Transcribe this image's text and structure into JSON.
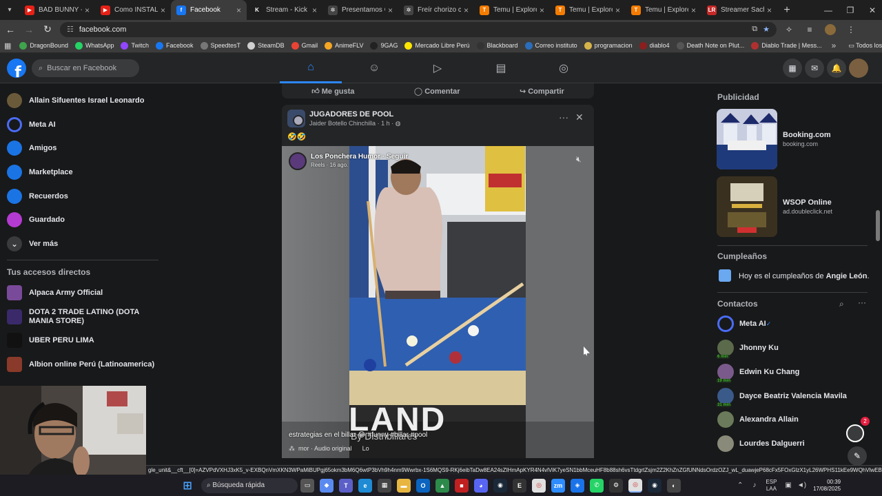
{
  "browser": {
    "tabs": [
      {
        "label": "BAD BUNNY - NI",
        "icon": "youtube-icon",
        "color": "#e62117",
        "glyph": "▶"
      },
      {
        "label": "Como INSTALAR",
        "icon": "youtube-icon",
        "color": "#e62117",
        "glyph": "▶"
      },
      {
        "label": "Facebook",
        "icon": "facebook-icon",
        "color": "#1877f2",
        "glyph": "f",
        "active": true
      },
      {
        "label": "Stream - Kick Da",
        "icon": "kick-icon",
        "color": "#1e1e1e",
        "glyph": "K"
      },
      {
        "label": "Presentamos Cha",
        "icon": "openai-icon",
        "color": "#444444",
        "glyph": "✲"
      },
      {
        "label": "Freír chorizo con",
        "icon": "openai-icon",
        "color": "#444444",
        "glyph": "✲"
      },
      {
        "label": "Temu | Explore th",
        "icon": "temu-icon",
        "color": "#f57c00",
        "glyph": "T"
      },
      {
        "label": "Temu | Explore th",
        "icon": "temu-icon",
        "color": "#f57c00",
        "glyph": "T"
      },
      {
        "label": "Temu | Explore th",
        "icon": "temu-icon",
        "color": "#f57c00",
        "glyph": "T"
      },
      {
        "label": "Streamer Sacha c",
        "icon": "news-icon",
        "color": "#c62828",
        "glyph": "LR"
      }
    ],
    "url": "facebook.com",
    "bookmarks": [
      {
        "label": "DragonBound",
        "color": "#3fa34d"
      },
      {
        "label": "WhatsApp",
        "color": "#25d366"
      },
      {
        "label": "Twitch",
        "color": "#9146ff"
      },
      {
        "label": "Facebook",
        "color": "#1877f2"
      },
      {
        "label": "SpeedtesT",
        "color": "#777777"
      },
      {
        "label": "SteamDB",
        "color": "#cfcfcf"
      },
      {
        "label": "Gmail",
        "color": "#ea4335"
      },
      {
        "label": "AnimeFLV",
        "color": "#f5a623"
      },
      {
        "label": "9GAG",
        "color": "#222222"
      },
      {
        "label": "Mercado Libre Perú",
        "color": "#ffe600"
      },
      {
        "label": "Blackboard",
        "color": "#333333"
      },
      {
        "label": "Correo instituto",
        "color": "#2a6ebb"
      },
      {
        "label": "programacion",
        "color": "#d6b34a"
      },
      {
        "label": "diablo4",
        "color": "#8b1e1e"
      },
      {
        "label": "Death Note on Plut...",
        "color": "#555555"
      },
      {
        "label": "Diablo Trade | Mess...",
        "color": "#b03030"
      }
    ],
    "bookmarks_more": "»",
    "all_bookmarks": "Todos los marcadores"
  },
  "fb": {
    "search_placeholder": "Buscar en Facebook",
    "left_menu": [
      {
        "label": "Allain Sifuentes Israel Leonardo",
        "icon": "profile-avatar-icon",
        "color": "#6b5a3a"
      },
      {
        "label": "Meta AI",
        "icon": "meta-ai-icon",
        "color": "#4a6cf7"
      },
      {
        "label": "Amigos",
        "icon": "friends-icon",
        "color": "#1b74e4"
      },
      {
        "label": "Marketplace",
        "icon": "marketplace-icon",
        "color": "#1b74e4"
      },
      {
        "label": "Recuerdos",
        "icon": "memories-icon",
        "color": "#1b74e4"
      },
      {
        "label": "Guardado",
        "icon": "saved-icon",
        "color": "#b43bd1"
      },
      {
        "label": "Ver más",
        "icon": "chevron-down-icon",
        "color": "#3a3b3c"
      }
    ],
    "shortcuts_title": "Tus accesos directos",
    "shortcuts": [
      {
        "label": "Alpaca Army Official",
        "color": "#7a4a9a"
      },
      {
        "label": "DOTA 2 TRADE LATINO (DOTA MANIA STORE)",
        "color": "#3a2a6a"
      },
      {
        "label": "UBER PERU LIMA",
        "color": "#111111"
      },
      {
        "label": "Albion online Perú (Latinoamerica)",
        "color": "#8a3a2a"
      }
    ],
    "actions": {
      "like": "Me gusta",
      "comment": "Comentar",
      "share": "Compartir"
    },
    "post": {
      "group": "JUGADORES DE POOL",
      "author": "Jaider Botello Chinchilla",
      "time": "1 h",
      "emoji": "🤣🤣",
      "reel_page": "Los Ponchera Humor · Seguir",
      "reel_meta": "Reels · 16 ago.",
      "caption": "estrategias en el billar 😂 #funny #billar #pool",
      "audio": "mor · Audio original",
      "audio_cut": "Lo",
      "watermark_big": "LAND",
      "watermark_small": "By Distribillares"
    },
    "ads_title": "Publicidad",
    "ads": [
      {
        "name": "Booking.com",
        "domain": "booking.com"
      },
      {
        "name": "WSOP Online",
        "domain": "ad.doubleclick.net"
      }
    ],
    "birthdays_title": "Cumpleaños",
    "birthday_text": "Hoy es el cumpleaños de",
    "birthday_name": "Angie León",
    "contacts_title": "Contactos",
    "contacts": [
      {
        "name": "Meta AI",
        "color": "#4a6cf7",
        "min": ""
      },
      {
        "name": "Jhonny Ku",
        "color": "#5a6a4a",
        "min": "6 min"
      },
      {
        "name": "Edwin Ku Chang",
        "color": "#7a5a8a",
        "min": "19 min"
      },
      {
        "name": "Dayce Beatriz Valencia Mavila",
        "color": "#3a5a8a",
        "min": "31 min"
      },
      {
        "name": "Alexandra Allain",
        "color": "#6a7a5a",
        "min": ""
      },
      {
        "name": "Lourdes Dalguerri",
        "color": "#8a8a7a",
        "min": ""
      }
    ],
    "chat_badge": "2"
  },
  "status_url": "gle_unit&__cft__[0]=AZVPdVXHJ3xK5_v-EXBQnVmXKN3WPaMiBUPgj65okm3bM6Q6wtP3bVh9h4nm9Wwrbx-1S6MQS9-RKj6eibTaDw8EA24sZIHmApKYR4N4vlViK7yeSN1bbMceuHF8b88sh6vsTtdgrtZsjm2Z2KhZnZGfUNNdsOrdzOZJ_wL_duawjeP68cFx5FOxGlzX1yL26WPHS11kEe9WQhVlwEBeVV...",
  "taskbar": {
    "search": "Búsqueda rápida",
    "lang1": "ESP",
    "lang2": "LAA",
    "time": "00:39",
    "date": "17/08/2025"
  }
}
